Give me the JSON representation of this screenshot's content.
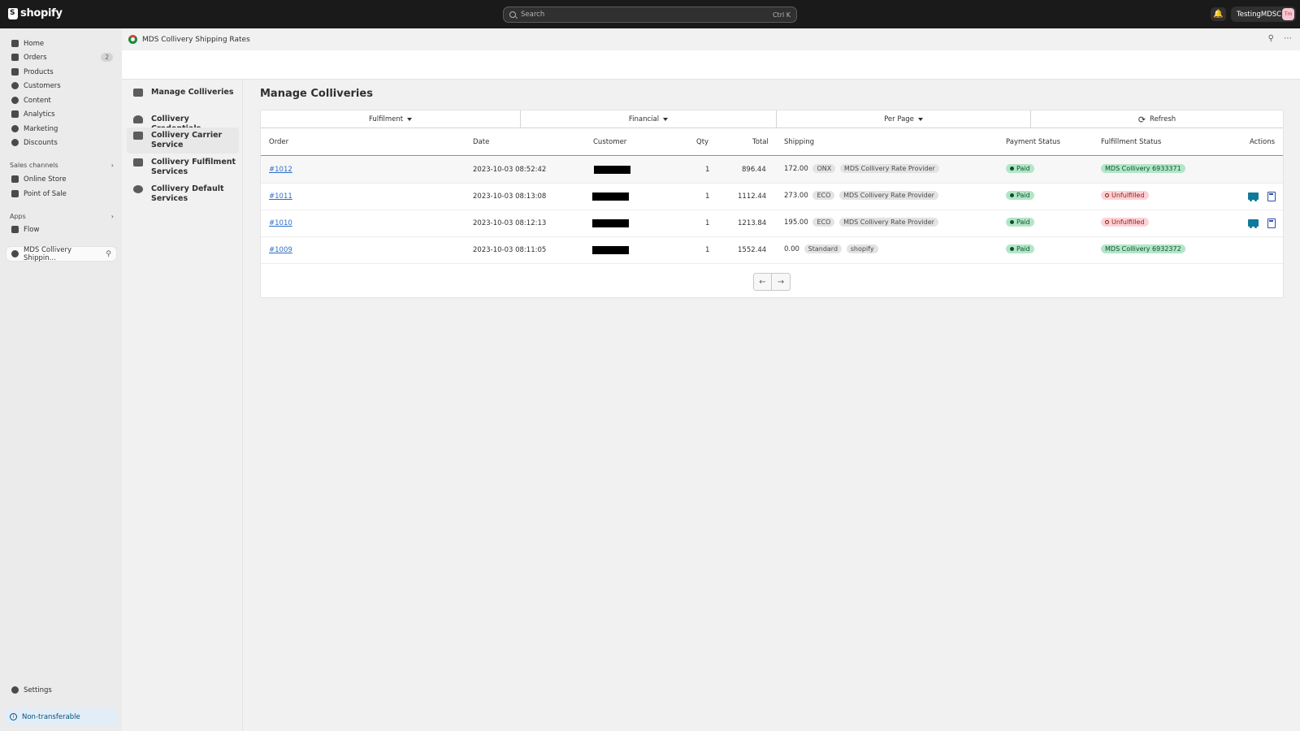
{
  "topbar": {
    "brand": "shopify",
    "search_placeholder": "Search",
    "search_shortcut": "Ctrl K",
    "store_name": "TestingMDSC",
    "avatar_initials": "Tm"
  },
  "sidebar": {
    "items": [
      {
        "label": "Home",
        "icon": "home-icon"
      },
      {
        "label": "Orders",
        "icon": "inbox-icon",
        "badge": "2"
      },
      {
        "label": "Products",
        "icon": "tag-icon"
      },
      {
        "label": "Customers",
        "icon": "person-icon"
      },
      {
        "label": "Content",
        "icon": "content-icon"
      },
      {
        "label": "Analytics",
        "icon": "chart-icon"
      },
      {
        "label": "Marketing",
        "icon": "target-icon"
      },
      {
        "label": "Discounts",
        "icon": "discount-icon"
      }
    ],
    "sales_channels_label": "Sales channels",
    "channels": [
      {
        "label": "Online Store",
        "icon": "store-icon"
      },
      {
        "label": "Point of Sale",
        "icon": "pos-icon"
      }
    ],
    "apps_label": "Apps",
    "apps": [
      {
        "label": "Flow",
        "icon": "flow-icon"
      }
    ],
    "active_app": "MDS Collivery Shippin...",
    "settings_label": "Settings",
    "nontransferable_label": "Non-transferable"
  },
  "app_header": {
    "title": "MDS Collivery Shipping Rates"
  },
  "subnav": {
    "items": [
      {
        "label": "Manage Colliveries",
        "icon": "inbox-icon"
      },
      {
        "label": "Collivery Credentials",
        "icon": "person-icon"
      },
      {
        "label": "Collivery Carrier Service",
        "icon": "truck-icon"
      },
      {
        "label": "Collivery Fulfilment Services",
        "icon": "list-icon"
      },
      {
        "label": "Collivery Default Services",
        "icon": "globe-icon"
      }
    ]
  },
  "main": {
    "title": "Manage Colliveries",
    "filters": {
      "fulfilment": "Fulfilment",
      "financial": "Financial",
      "per_page": "Per Page",
      "refresh": "Refresh"
    },
    "columns": {
      "order": "Order",
      "date": "Date",
      "customer": "Customer",
      "qty": "Qty",
      "total": "Total",
      "shipping": "Shipping",
      "payment_status": "Payment Status",
      "fulfillment_status": "Fulfillment Status",
      "actions": "Actions"
    },
    "rows": [
      {
        "order": "#1012",
        "date": "2023-10-03 08:52:42",
        "qty": "1",
        "total": "896.44",
        "shipping_amount": "172.00",
        "service": "ONX",
        "provider": "MDS Collivery Rate Provider",
        "payment": "Paid",
        "fulfillment": "MDS Collivery 6933371"
      },
      {
        "order": "#1011",
        "date": "2023-10-03 08:13:08",
        "qty": "1",
        "total": "1112.44",
        "shipping_amount": "273.00",
        "service": "ECO",
        "provider": "MDS Collivery Rate Provider",
        "payment": "Paid",
        "fulfillment": "Unfulfilled"
      },
      {
        "order": "#1010",
        "date": "2023-10-03 08:12:13",
        "qty": "1",
        "total": "1213.84",
        "shipping_amount": "195.00",
        "service": "ECO",
        "provider": "MDS Collivery Rate Provider",
        "payment": "Paid",
        "fulfillment": "Unfulfilled"
      },
      {
        "order": "#1009",
        "date": "2023-10-03 08:11:05",
        "qty": "1",
        "total": "1552.44",
        "shipping_amount": "0.00",
        "service": "Standard",
        "provider": "shopify",
        "payment": "Paid",
        "fulfillment": "MDS Collivery 6932372"
      }
    ],
    "pager": {
      "prev": "←",
      "next": "→"
    }
  },
  "colors": {
    "topbar": "#1a1a1a",
    "link": "#2c6ecb",
    "paid_bg": "#b3e6c6",
    "unfulfilled_bg": "#fed1d7",
    "truck": "#0f7a9b",
    "calc": "#2c4fa8"
  }
}
